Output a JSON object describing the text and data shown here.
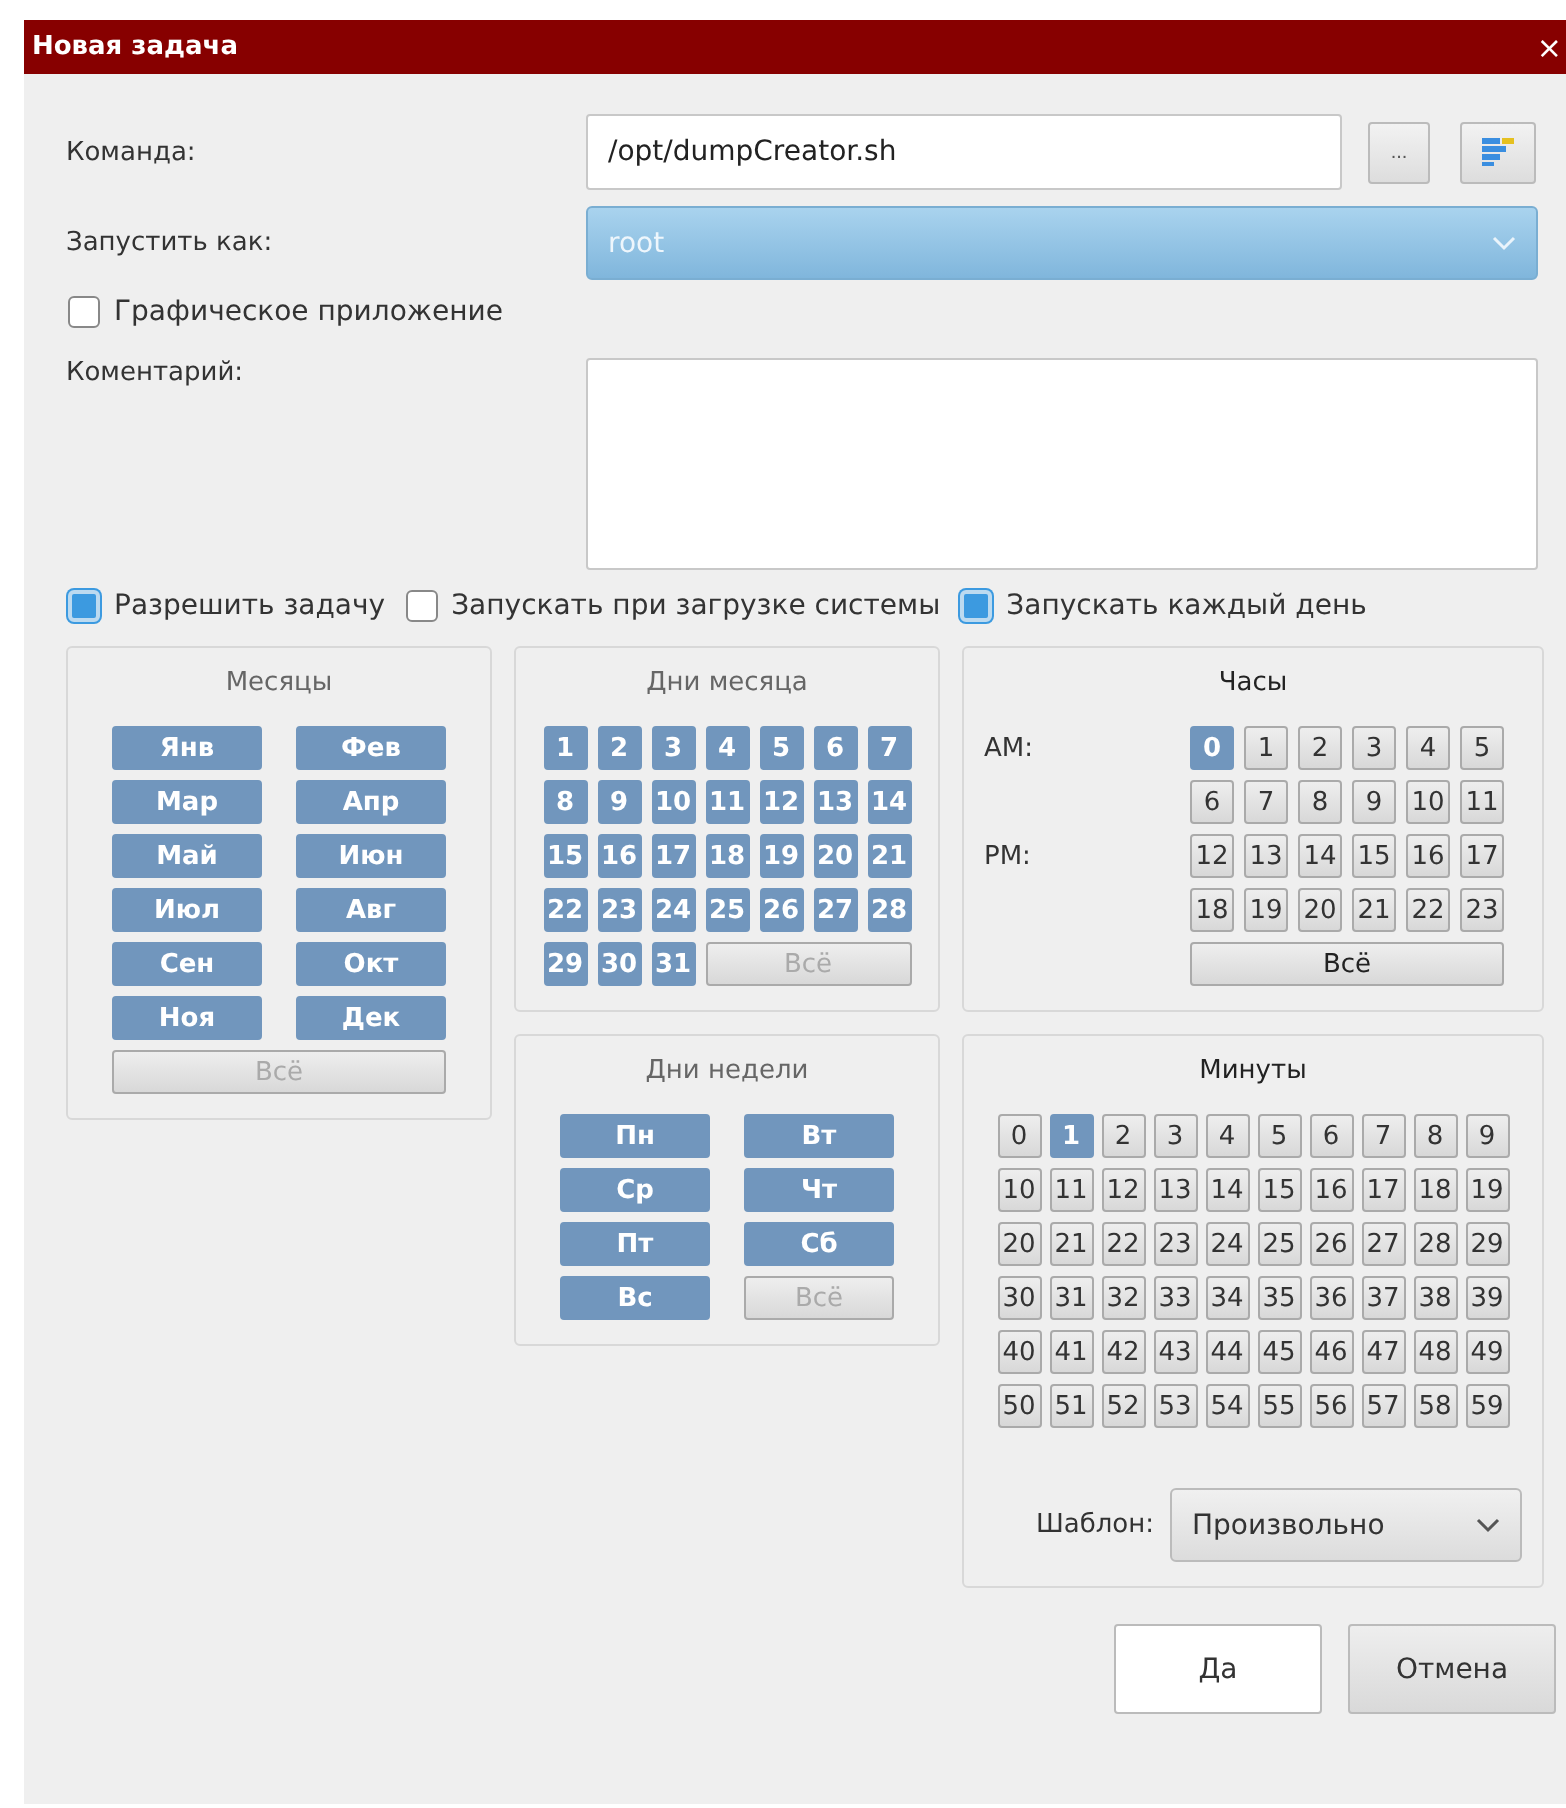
{
  "window": {
    "title": "Новая задача",
    "close": "×"
  },
  "command": {
    "label": "Команда:",
    "value": "/opt/dumpCreator.sh",
    "browse_button": "..."
  },
  "run_as": {
    "label": "Запустить как:",
    "value": "root"
  },
  "graphical": {
    "label": "Графическое приложение",
    "checked": false
  },
  "comment": {
    "label": "Коментарий:"
  },
  "options": [
    {
      "label": "Разрешить задачу",
      "checked": true
    },
    {
      "label": "Запускать при загрузке системы",
      "checked": false
    },
    {
      "label": "Запускать каждый день",
      "checked": true
    }
  ],
  "months": {
    "title": "Месяцы",
    "items": [
      {
        "label": "Янв",
        "selected": true
      },
      {
        "label": "Фев",
        "selected": true
      },
      {
        "label": "Мар",
        "selected": true
      },
      {
        "label": "Апр",
        "selected": true
      },
      {
        "label": "Май",
        "selected": true
      },
      {
        "label": "Июн",
        "selected": true
      },
      {
        "label": "Июл",
        "selected": true
      },
      {
        "label": "Авг",
        "selected": true
      },
      {
        "label": "Сен",
        "selected": true
      },
      {
        "label": "Окт",
        "selected": true
      },
      {
        "label": "Ноя",
        "selected": true
      },
      {
        "label": "Дек",
        "selected": true
      }
    ],
    "all_button": {
      "label": "Всё",
      "disabled": true
    }
  },
  "days_of_month": {
    "title": "Дни месяца",
    "items": [
      {
        "label": "1",
        "selected": true
      },
      {
        "label": "2",
        "selected": true
      },
      {
        "label": "3",
        "selected": true
      },
      {
        "label": "4",
        "selected": true
      },
      {
        "label": "5",
        "selected": true
      },
      {
        "label": "6",
        "selected": true
      },
      {
        "label": "7",
        "selected": true
      },
      {
        "label": "8",
        "selected": true
      },
      {
        "label": "9",
        "selected": true
      },
      {
        "label": "10",
        "selected": true
      },
      {
        "label": "11",
        "selected": true
      },
      {
        "label": "12",
        "selected": true
      },
      {
        "label": "13",
        "selected": true
      },
      {
        "label": "14",
        "selected": true
      },
      {
        "label": "15",
        "selected": true
      },
      {
        "label": "16",
        "selected": true
      },
      {
        "label": "17",
        "selected": true
      },
      {
        "label": "18",
        "selected": true
      },
      {
        "label": "19",
        "selected": true
      },
      {
        "label": "20",
        "selected": true
      },
      {
        "label": "21",
        "selected": true
      },
      {
        "label": "22",
        "selected": true
      },
      {
        "label": "23",
        "selected": true
      },
      {
        "label": "24",
        "selected": true
      },
      {
        "label": "25",
        "selected": true
      },
      {
        "label": "26",
        "selected": true
      },
      {
        "label": "27",
        "selected": true
      },
      {
        "label": "28",
        "selected": true
      },
      {
        "label": "29",
        "selected": true
      },
      {
        "label": "30",
        "selected": true
      },
      {
        "label": "31",
        "selected": true
      }
    ],
    "all_button": {
      "label": "Всё",
      "disabled": true
    }
  },
  "days_of_week": {
    "title": "Дни недели",
    "items": [
      {
        "label": "Пн",
        "selected": true
      },
      {
        "label": "Вт",
        "selected": true
      },
      {
        "label": "Ср",
        "selected": true
      },
      {
        "label": "Чт",
        "selected": true
      },
      {
        "label": "Пт",
        "selected": true
      },
      {
        "label": "Сб",
        "selected": true
      },
      {
        "label": "Вс",
        "selected": true
      }
    ],
    "all_button": {
      "label": "Всё",
      "disabled": true
    }
  },
  "hours": {
    "title": "Часы",
    "rows": [
      {
        "label": "AM:",
        "items": [
          {
            "label": "0",
            "selected": true
          },
          {
            "label": "1",
            "selected": false
          },
          {
            "label": "2",
            "selected": false
          },
          {
            "label": "3",
            "selected": false
          },
          {
            "label": "4",
            "selected": false
          },
          {
            "label": "5",
            "selected": false
          }
        ]
      },
      {
        "items": [
          {
            "label": "6",
            "selected": false
          },
          {
            "label": "7",
            "selected": false
          },
          {
            "label": "8",
            "selected": false
          },
          {
            "label": "9",
            "selected": false
          },
          {
            "label": "10",
            "selected": false
          },
          {
            "label": "11",
            "selected": false
          }
        ]
      },
      {
        "label": "PM:",
        "items": [
          {
            "label": "12",
            "selected": false
          },
          {
            "label": "13",
            "selected": false
          },
          {
            "label": "14",
            "selected": false
          },
          {
            "label": "15",
            "selected": false
          },
          {
            "label": "16",
            "selected": false
          },
          {
            "label": "17",
            "selected": false
          }
        ]
      },
      {
        "items": [
          {
            "label": "18",
            "selected": false
          },
          {
            "label": "19",
            "selected": false
          },
          {
            "label": "20",
            "selected": false
          },
          {
            "label": "21",
            "selected": false
          },
          {
            "label": "22",
            "selected": false
          },
          {
            "label": "23",
            "selected": false
          }
        ]
      }
    ],
    "all_button": {
      "label": "Всё",
      "disabled": false
    }
  },
  "minutes": {
    "title": "Минуты",
    "items": [
      {
        "label": "0",
        "selected": false
      },
      {
        "label": "1",
        "selected": true
      },
      {
        "label": "2",
        "selected": false
      },
      {
        "label": "3",
        "selected": false
      },
      {
        "label": "4",
        "selected": false
      },
      {
        "label": "5",
        "selected": false
      },
      {
        "label": "6",
        "selected": false
      },
      {
        "label": "7",
        "selected": false
      },
      {
        "label": "8",
        "selected": false
      },
      {
        "label": "9",
        "selected": false
      },
      {
        "label": "10",
        "selected": false
      },
      {
        "label": "11",
        "selected": false
      },
      {
        "label": "12",
        "selected": false
      },
      {
        "label": "13",
        "selected": false
      },
      {
        "label": "14",
        "selected": false
      },
      {
        "label": "15",
        "selected": false
      },
      {
        "label": "16",
        "selected": false
      },
      {
        "label": "17",
        "selected": false
      },
      {
        "label": "18",
        "selected": false
      },
      {
        "label": "19",
        "selected": false
      },
      {
        "label": "20",
        "selected": false
      },
      {
        "label": "21",
        "selected": false
      },
      {
        "label": "22",
        "selected": false
      },
      {
        "label": "23",
        "selected": false
      },
      {
        "label": "24",
        "selected": false
      },
      {
        "label": "25",
        "selected": false
      },
      {
        "label": "26",
        "selected": false
      },
      {
        "label": "27",
        "selected": false
      },
      {
        "label": "28",
        "selected": false
      },
      {
        "label": "29",
        "selected": false
      },
      {
        "label": "30",
        "selected": false
      },
      {
        "label": "31",
        "selected": false
      },
      {
        "label": "32",
        "selected": false
      },
      {
        "label": "33",
        "selected": false
      },
      {
        "label": "34",
        "selected": false
      },
      {
        "label": "35",
        "selected": false
      },
      {
        "label": "36",
        "selected": false
      },
      {
        "label": "37",
        "selected": false
      },
      {
        "label": "38",
        "selected": false
      },
      {
        "label": "39",
        "selected": false
      },
      {
        "label": "40",
        "selected": false
      },
      {
        "label": "41",
        "selected": false
      },
      {
        "label": "42",
        "selected": false
      },
      {
        "label": "43",
        "selected": false
      },
      {
        "label": "44",
        "selected": false
      },
      {
        "label": "45",
        "selected": false
      },
      {
        "label": "46",
        "selected": false
      },
      {
        "label": "47",
        "selected": false
      },
      {
        "label": "48",
        "selected": false
      },
      {
        "label": "49",
        "selected": false
      },
      {
        "label": "50",
        "selected": false
      },
      {
        "label": "51",
        "selected": false
      },
      {
        "label": "52",
        "selected": false
      },
      {
        "label": "53",
        "selected": false
      },
      {
        "label": "54",
        "selected": false
      },
      {
        "label": "55",
        "selected": false
      },
      {
        "label": "56",
        "selected": false
      },
      {
        "label": "57",
        "selected": false
      },
      {
        "label": "58",
        "selected": false
      },
      {
        "label": "59",
        "selected": false
      }
    ],
    "template": {
      "label": "Шаблон:",
      "value": "Произвольно"
    }
  },
  "buttons": [
    {
      "label": "Да",
      "default": true
    },
    {
      "label": "Отмена",
      "default": false
    }
  ]
}
